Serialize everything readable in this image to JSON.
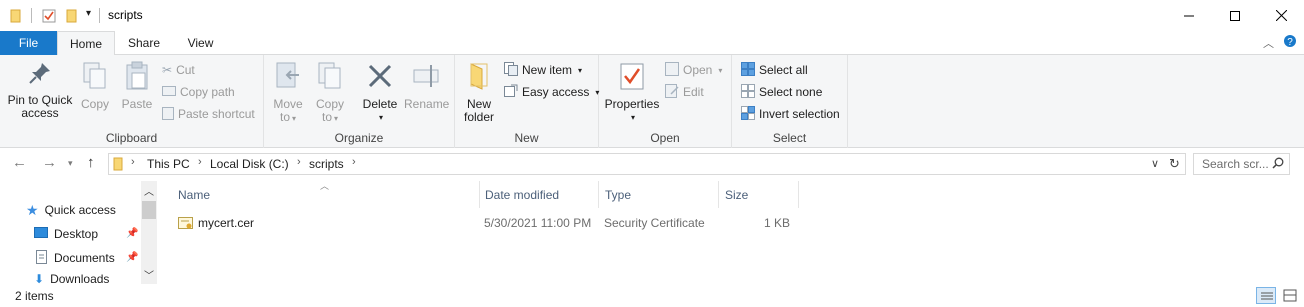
{
  "window": {
    "title": "scripts"
  },
  "tabs": {
    "file": "File",
    "home": "Home",
    "share": "Share",
    "view": "View"
  },
  "ribbon": {
    "clipboard": {
      "label": "Clipboard",
      "pin_line1": "Pin to Quick",
      "pin_line2": "access",
      "copy": "Copy",
      "paste": "Paste",
      "cut": "Cut",
      "copy_path": "Copy path",
      "paste_shortcut": "Paste shortcut"
    },
    "organize": {
      "label": "Organize",
      "move_to_line1": "Move",
      "move_to_line2": "to",
      "copy_to_line1": "Copy",
      "copy_to_line2": "to",
      "delete": "Delete",
      "rename": "Rename"
    },
    "new": {
      "label": "New",
      "new_folder_line1": "New",
      "new_folder_line2": "folder",
      "new_item": "New item",
      "easy_access": "Easy access"
    },
    "open": {
      "label": "Open",
      "properties": "Properties",
      "open": "Open",
      "edit": "Edit"
    },
    "select": {
      "label": "Select",
      "select_all": "Select all",
      "select_none": "Select none",
      "invert_selection": "Invert selection"
    }
  },
  "address": {
    "crumbs": [
      "This PC",
      "Local Disk (C:)",
      "scripts"
    ],
    "search_placeholder": "Search scr..."
  },
  "navpane": {
    "items": [
      "Quick access",
      "Desktop",
      "Documents",
      "Downloads"
    ]
  },
  "filelist": {
    "columns": [
      "Name",
      "Date modified",
      "Type",
      "Size"
    ],
    "rows": [
      {
        "name": "mycert.cer",
        "date": "5/30/2021 11:00 PM",
        "type": "Security Certificate",
        "size": "1 KB"
      }
    ]
  },
  "status": {
    "item_count": "2 items"
  },
  "colors": {
    "accent": "#1979ca",
    "ribbon_bg": "#f5f6f7",
    "folder": "#f8d775"
  }
}
